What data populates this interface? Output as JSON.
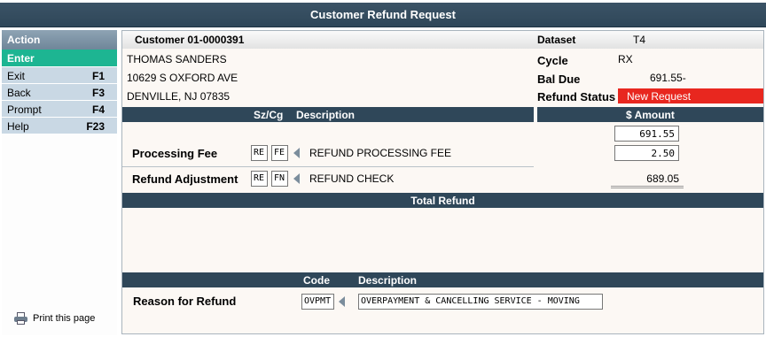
{
  "window": {
    "title": "Customer Refund Request"
  },
  "actions": {
    "header": "Action",
    "enter": "Enter",
    "items": [
      {
        "label": "Exit",
        "key": "F1"
      },
      {
        "label": "Back",
        "key": "F3"
      },
      {
        "label": "Prompt",
        "key": "F4"
      },
      {
        "label": "Help",
        "key": "F23"
      }
    ]
  },
  "print_label": "Print this page",
  "customer": {
    "header": "Customer 01-0000391",
    "name": "THOMAS SANDERS",
    "address1": "10629 S OXFORD AVE",
    "address2": "DENVILLE, NJ 07835"
  },
  "info": {
    "dataset_label": "Dataset",
    "dataset_value": "T4",
    "cycle_label": "Cycle",
    "cycle_value": "RX",
    "baldue_label": "Bal Due",
    "baldue_value": "691.55-",
    "status_label": "Refund Status",
    "status_value": "New Request"
  },
  "colors": {
    "header_bar": "#2f4759",
    "status_bg": "#e8271f",
    "enter_bg": "#1db592",
    "action_item_bg": "#c9d8e4"
  },
  "table": {
    "col_szcg": "Sz/Cg",
    "col_description": "Description",
    "col_amount": "$ Amount",
    "amount_top": "691.55",
    "rows": [
      {
        "label": "Processing Fee",
        "sz": "RE",
        "cg": "FE",
        "description": "REFUND PROCESSING FEE",
        "amount": "2.50"
      },
      {
        "label": "Refund Adjustment",
        "sz": "RE",
        "cg": "FN",
        "description": "REFUND CHECK",
        "amount": "689.05"
      }
    ]
  },
  "total_refund_label": "Total Refund",
  "reason": {
    "col_code": "Code",
    "col_description": "Description",
    "label": "Reason for Refund",
    "code": "OVPMT",
    "description": "OVERPAYMENT & CANCELLING SERVICE - MOVING"
  }
}
